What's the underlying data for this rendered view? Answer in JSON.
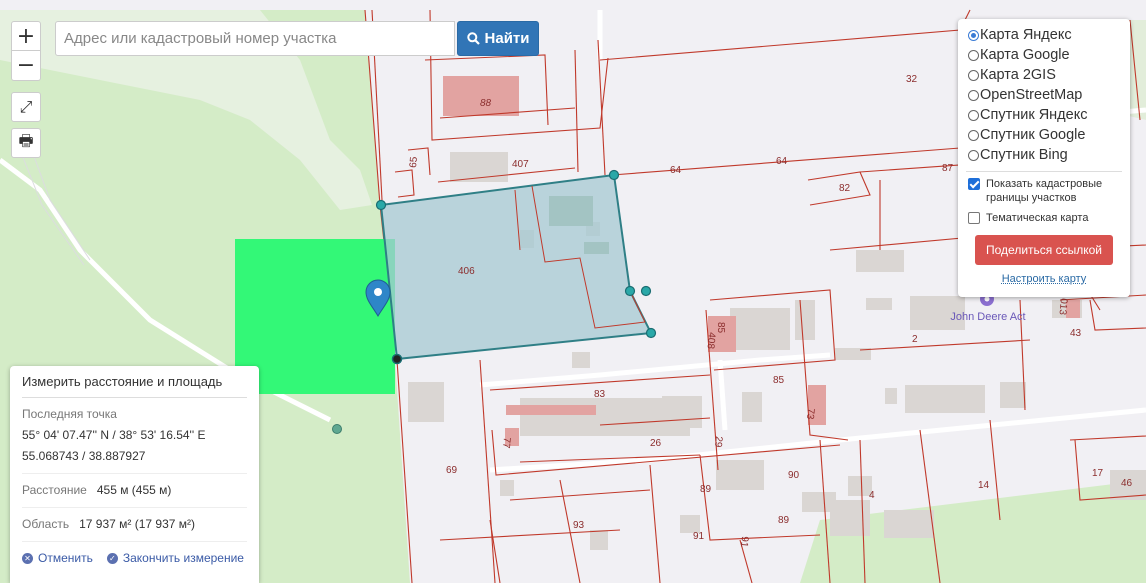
{
  "search": {
    "placeholder": "Адрес или кадастровый номер участка",
    "button_label": "Найти"
  },
  "controls": {
    "zoom_in": "+",
    "zoom_out": "−",
    "fullscreen": "⤢",
    "print": "🖶"
  },
  "layers": [
    {
      "label": "Карта Яндекс",
      "selected": true
    },
    {
      "label": "Карта Google",
      "selected": false
    },
    {
      "label": "Карта 2GIS",
      "selected": false
    },
    {
      "label": "OpenStreetMap",
      "selected": false
    },
    {
      "label": "Спутник Яндекс",
      "selected": false
    },
    {
      "label": "Спутник Google",
      "selected": false
    },
    {
      "label": "Спутник Bing",
      "selected": false
    }
  ],
  "options": {
    "show_cadastral": {
      "label": "Показать кадастровые границы участков",
      "checked": true
    },
    "thematic": {
      "label": "Тематическая карта",
      "checked": false
    }
  },
  "share_button": "Поделиться ссылкой",
  "configure_link": "Настроить карту",
  "measure": {
    "title": "Измерить расстояние и площадь",
    "last_point_label": "Последняя точка",
    "last_point_dms": "55° 04' 07.47'' N / 38° 53' 16.54'' E",
    "last_point_decimal": "55.068743 / 38.887927",
    "distance_label": "Расстояние",
    "distance_value": "455 м (455 м)",
    "area_label": "Область",
    "area_value": "17 937 м² (17 937 м²)",
    "cancel_label": "Отменить",
    "finish_label": "Закончить измерение"
  },
  "map_labels": {
    "p88": "88",
    "p65": "65",
    "p407": "407",
    "p64a": "64",
    "p64b": "64",
    "p32": "32",
    "p82": "82",
    "p87": "87",
    "p406": "406",
    "p408": "408",
    "p85a": "85",
    "p85b": "85",
    "p2": "2",
    "p43": "43",
    "p83": "83",
    "p26": "26",
    "p77": "77",
    "p29": "29",
    "p73": "73",
    "p69": "69",
    "p90": "90",
    "p89a": "89",
    "p89b": "89",
    "p4": "4",
    "p14": "14",
    "p46": "46",
    "p17": "17",
    "p93": "93",
    "p91": "91",
    "p91b": "91",
    "p013": "013",
    "poi": "John Deere Act"
  },
  "colors": {
    "measure_fill": "#a6cad3",
    "measure_stroke": "#2f7f86",
    "green_rect": "#33f877",
    "cadastral": "#c0392b",
    "forest": "#d2ebc4",
    "marker": "#2e86c8",
    "poi": "#7a5fc9"
  }
}
